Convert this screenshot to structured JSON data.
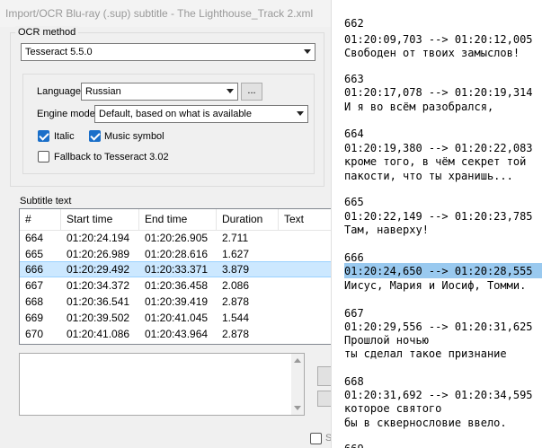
{
  "window": {
    "title": "Import/OCR Blu-ray (.sup) subtitle - The Lighthouse_Track 2.xml"
  },
  "ocr": {
    "group_label": "OCR method",
    "method_value": "Tesseract 5.5.0",
    "language_label": "Language",
    "language_value": "Russian",
    "language_button": "...",
    "engine_label": "Engine mode",
    "engine_value": "Default, based on what is available",
    "italic_label": "Italic",
    "italic_checked": true,
    "music_label": "Music symbol",
    "music_checked": true,
    "fallback_label": "Fallback to Tesseract 3.02",
    "fallback_checked": false
  },
  "subtitle": {
    "label": "Subtitle text",
    "columns": [
      "#",
      "Start time",
      "End time",
      "Duration",
      "Text"
    ],
    "rows": [
      {
        "num": "664",
        "start": "01:20:24.194",
        "end": "01:20:26.905",
        "duration": "2.711",
        "text": ""
      },
      {
        "num": "665",
        "start": "01:20:26.989",
        "end": "01:20:28.616",
        "duration": "1.627",
        "text": ""
      },
      {
        "num": "666",
        "start": "01:20:29.492",
        "end": "01:20:33.371",
        "duration": "3.879",
        "text": "",
        "selected": true
      },
      {
        "num": "667",
        "start": "01:20:34.372",
        "end": "01:20:36.458",
        "duration": "2.086",
        "text": ""
      },
      {
        "num": "668",
        "start": "01:20:36.541",
        "end": "01:20:39.419",
        "duration": "2.878",
        "text": ""
      },
      {
        "num": "669",
        "start": "01:20:39.502",
        "end": "01:20:41.045",
        "duration": "1.544",
        "text": ""
      },
      {
        "num": "670",
        "start": "01:20:41.086",
        "end": "01:20:43.964",
        "duration": "2.878",
        "text": ""
      }
    ]
  },
  "bottom_partial_label": "S",
  "srt": {
    "lines": [
      "662",
      "01:20:09,703 --> 01:20:12,005",
      "Свободен от твоих замыслов!",
      "",
      "663",
      "01:20:17,078 --> 01:20:19,314",
      "И я во всём разобрался,",
      "",
      "664",
      "01:20:19,380 --> 01:20:22,083",
      "кроме того, в чём секрет той",
      "пакости, что ты хранишь...",
      "",
      "665",
      "01:20:22,149 --> 01:20:23,785",
      "Там, наверху!",
      "",
      "666",
      "01:20:24,650 --> 01:20:28,555",
      "Иисус, Мария и Иосиф, Томми.",
      "",
      "667",
      "01:20:29,556 --> 01:20:31,625",
      "Прошлой ночью",
      "ты сделал такое признание",
      "",
      "668",
      "01:20:31,692 --> 01:20:34,595",
      "которое святого",
      "бы в сквернословие ввело.",
      "",
      "669"
    ],
    "highlight_color": "#99c9ef"
  }
}
